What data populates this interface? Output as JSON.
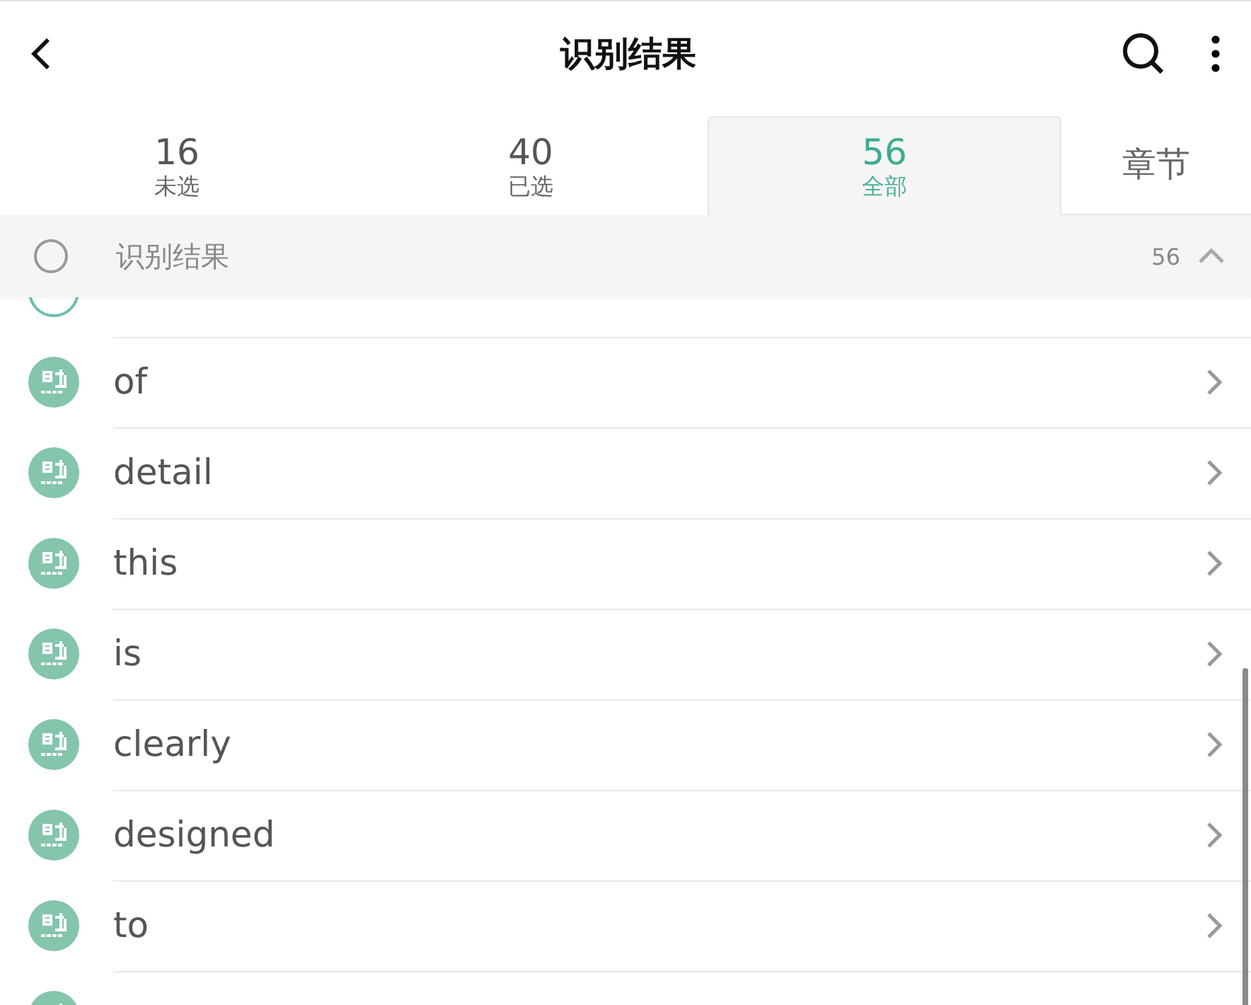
{
  "title": "识别结果",
  "tabs": [
    {
      "count": "16",
      "label": "未选",
      "selected": false
    },
    {
      "count": "40",
      "label": "已选",
      "selected": false
    },
    {
      "count": "56",
      "label": "全部",
      "selected": true
    }
  ],
  "chapter_tab": "章节",
  "group": {
    "title": "识别结果",
    "count": "56",
    "expanded": true,
    "checked": false
  },
  "items": [
    {
      "kind": "outline"
    },
    {
      "label": "of",
      "kind": "badge"
    },
    {
      "label": "detail",
      "kind": "badge"
    },
    {
      "label": "this",
      "kind": "badge"
    },
    {
      "label": "is",
      "kind": "badge"
    },
    {
      "label": "clearly",
      "kind": "badge"
    },
    {
      "label": "designed",
      "kind": "badge"
    },
    {
      "label": "to",
      "kind": "badge"
    },
    {
      "kind": "badge"
    }
  ]
}
